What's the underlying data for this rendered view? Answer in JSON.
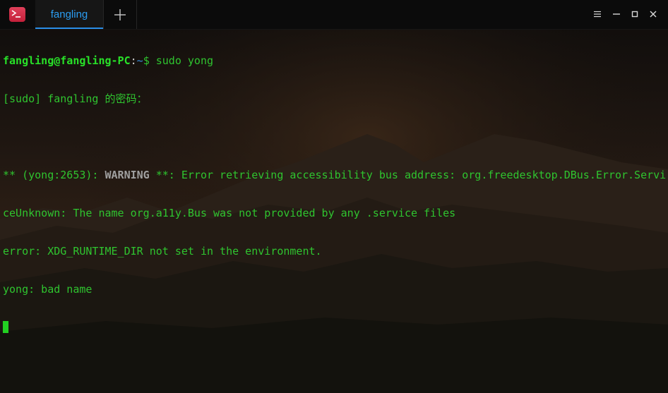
{
  "window": {
    "tab_title": "fangling",
    "icons": {
      "app": "terminal-app-icon",
      "new_tab": "plus-icon",
      "menu": "hamburger-menu-icon",
      "minimize": "minimize-icon",
      "maximize": "maximize-icon",
      "close": "close-icon"
    },
    "colors": {
      "accent": "#2b9df2",
      "text_green": "#2fc42f",
      "prompt_green": "#28e028",
      "prompt_path_blue": "#3b8edc",
      "app_icon_red": "#d0304a"
    }
  },
  "terminal": {
    "line1": {
      "user_host": "fangling@fangling-PC",
      "colon": ":",
      "path": "~",
      "command": "$ sudo yong"
    },
    "line2": "[sudo] fangling 的密码：",
    "line3": "",
    "line4": {
      "prefix": "** (yong:2653): ",
      "warning": "WARNING",
      "rest": " **: Error retrieving accessibility bus address: org.freedesktop.DBus.Error.Servi"
    },
    "line5": "ceUnknown: The name org.a11y.Bus was not provided by any .service files",
    "line6": "error: XDG_RUNTIME_DIR not set in the environment.",
    "line7": "yong: bad name"
  }
}
